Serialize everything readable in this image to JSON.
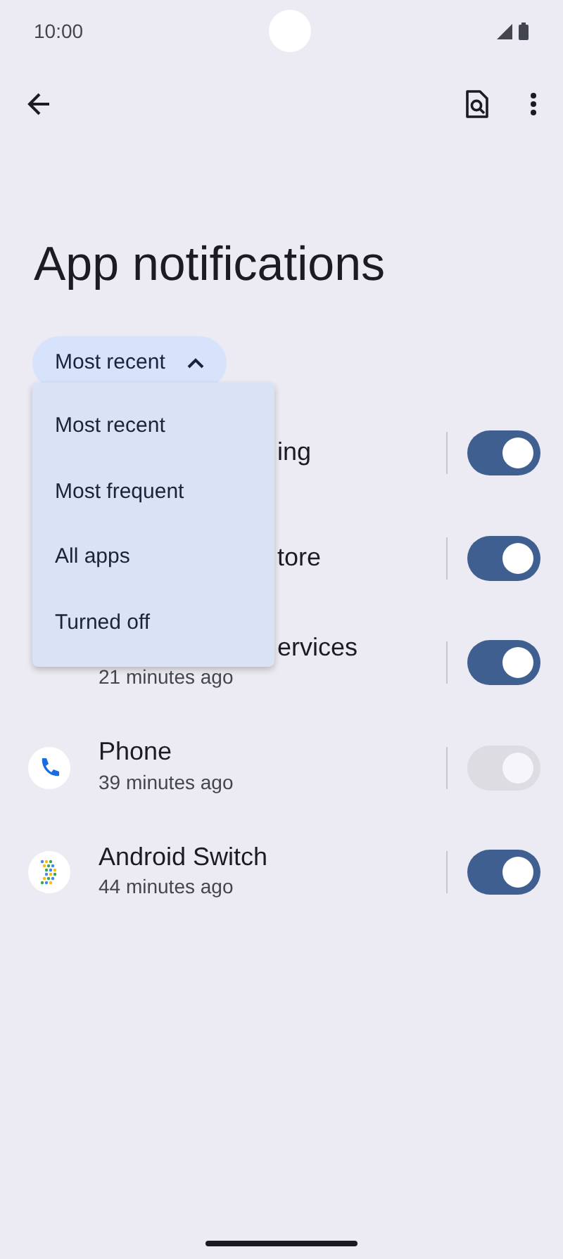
{
  "status_bar": {
    "time": "10:00"
  },
  "title": "App notifications",
  "sort_chip": {
    "label": "Most recent",
    "expanded": true
  },
  "sort_menu": [
    {
      "label": "Most recent"
    },
    {
      "label": "Most frequent"
    },
    {
      "label": "All apps"
    },
    {
      "label": "Turned off"
    }
  ],
  "apps": [
    {
      "name": "ing",
      "covered": true,
      "on": true,
      "disabled": false
    },
    {
      "name": "tore",
      "covered": true,
      "on": true,
      "disabled": false
    },
    {
      "name": "ervices",
      "subtitle": "21 minutes ago",
      "covered": true,
      "on": true,
      "disabled": false
    },
    {
      "name": "Phone",
      "subtitle": "39 minutes ago",
      "kind": "phone",
      "covered": false,
      "on": true,
      "disabled": true
    },
    {
      "name": "Android Switch",
      "subtitle": "44 minutes ago",
      "kind": "switch",
      "covered": false,
      "on": true,
      "disabled": false
    }
  ]
}
